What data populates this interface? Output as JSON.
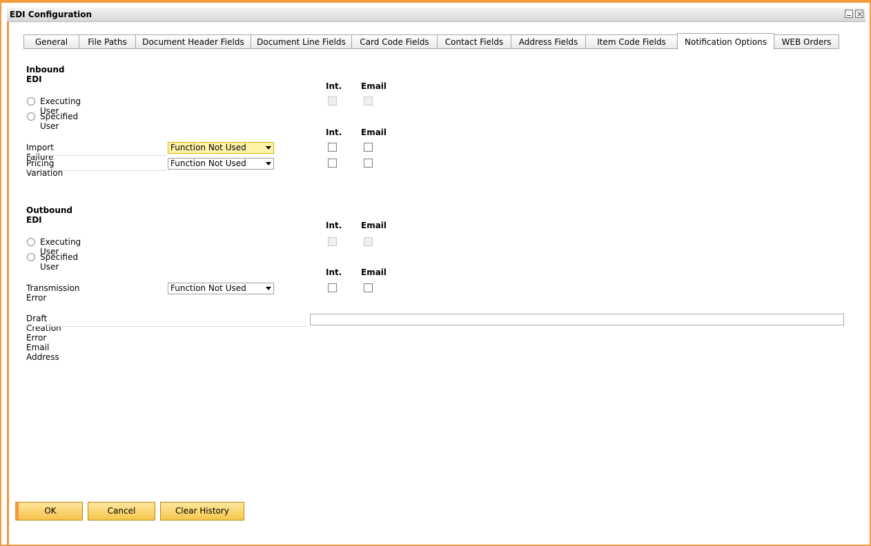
{
  "window": {
    "title": "EDI Configuration"
  },
  "tabs": [
    {
      "label": "General"
    },
    {
      "label": "File Paths"
    },
    {
      "label": "Document Header Fields"
    },
    {
      "label": "Document Line Fields"
    },
    {
      "label": "Card Code Fields"
    },
    {
      "label": "Contact Fields"
    },
    {
      "label": "Address Fields"
    },
    {
      "label": "Item Code Fields"
    },
    {
      "label": "Notification Options",
      "active": true
    },
    {
      "label": "WEB Orders"
    }
  ],
  "inbound": {
    "heading": "Inbound EDI",
    "col_int": "Int.",
    "col_email": "Email",
    "executing_user": "Executing User",
    "specified_user": "Specified User",
    "col_int2": "Int.",
    "col_email2": "Email",
    "import_failure": {
      "label": "Import Failure",
      "value": "Function Not Used"
    },
    "pricing_variation": {
      "label": "Pricing Variation",
      "value": "Function Not Used"
    }
  },
  "outbound": {
    "heading": "Outbound EDI",
    "col_int": "Int.",
    "col_email": "Email",
    "executing_user": "Executing User",
    "specified_user": "Specified User",
    "col_int2": "Int.",
    "col_email2": "Email",
    "transmission_error": {
      "label": "Transmission Error",
      "value": "Function Not Used"
    }
  },
  "draft_email": {
    "label": "Draft Creation Error Email Address",
    "value": ""
  },
  "buttons": {
    "ok": "OK",
    "cancel": "Cancel",
    "clear_history": "Clear History"
  },
  "colors": {
    "accent": "#f29a3c",
    "button": "#f5c64c",
    "highlight": "#fff3a9"
  }
}
